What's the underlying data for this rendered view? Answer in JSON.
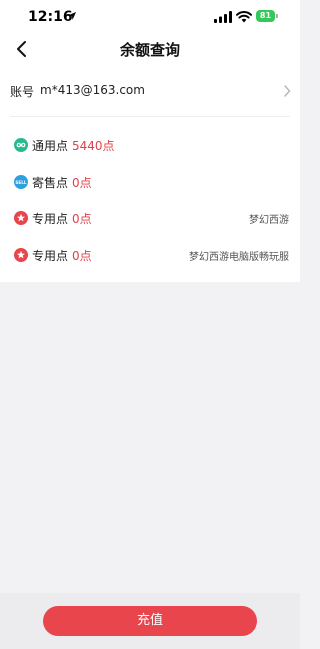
{
  "status_bar": {
    "time": "12:16",
    "battery": "81"
  },
  "nav": {
    "title": "余额查询"
  },
  "account": {
    "label": "账号",
    "value": "m*413@163.com"
  },
  "points": [
    {
      "icon": "infinity-icon",
      "icon_color": "#27b98f",
      "label": "通用点",
      "value": "5440点",
      "note": ""
    },
    {
      "icon": "sell-icon",
      "icon_color": "#2f9fe0",
      "icon_text": "SELL",
      "label": "寄售点",
      "value": "0点",
      "note": ""
    },
    {
      "icon": "star-icon",
      "icon_color": "#e8454d",
      "label": "专用点",
      "value": "0点",
      "note": "梦幻西游"
    },
    {
      "icon": "star-icon",
      "icon_color": "#e8454d",
      "label": "专用点",
      "value": "0点",
      "note": "梦幻西游电脑版畅玩服"
    }
  ],
  "footer": {
    "button_label": "充值"
  },
  "colors": {
    "accent": "#e8454d",
    "value_red": "#e0404a",
    "background": "#f2f2f4"
  }
}
